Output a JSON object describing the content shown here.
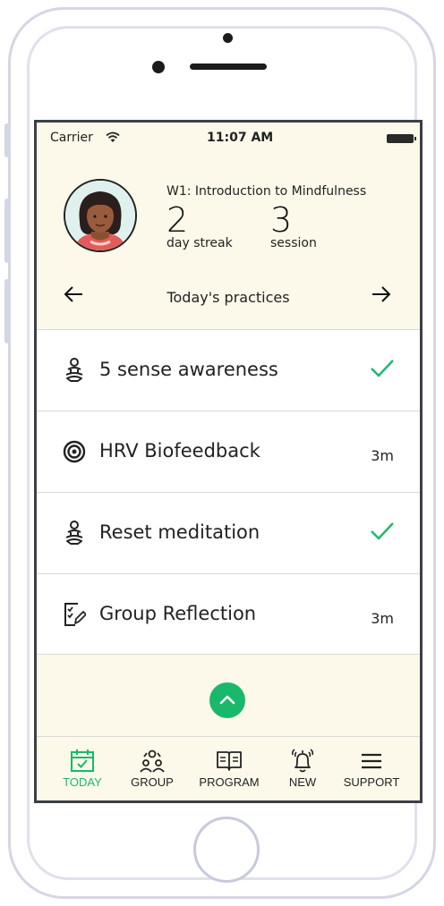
{
  "status_bar": {
    "carrier": "Carrier",
    "time": "11:07 AM"
  },
  "profile": {
    "program_title": "W1: Introduction to Mindfulness",
    "streak_value": "2",
    "streak_label": "day streak",
    "session_value": "3",
    "session_label": "session"
  },
  "navigation": {
    "prev_icon": "arrow-left-icon",
    "title": "Today's practices",
    "next_icon": "arrow-right-icon"
  },
  "practices": [
    {
      "label": "5 sense awareness",
      "icon": "meditation-icon",
      "completed": true,
      "duration": ""
    },
    {
      "label": "HRV Biofeedback",
      "icon": "target-icon",
      "completed": false,
      "duration": "3m"
    },
    {
      "label": "Reset meditation",
      "icon": "meditation-icon",
      "completed": true,
      "duration": ""
    },
    {
      "label": "Group Reflection",
      "icon": "journal-icon",
      "completed": false,
      "duration": "3m"
    }
  ],
  "scroll_up_icon": "chevron-up-icon",
  "tabbar": {
    "active": "TODAY",
    "tabs": [
      {
        "label": "TODAY",
        "icon": "calendar-check-icon"
      },
      {
        "label": "GROUP",
        "icon": "group-icon"
      },
      {
        "label": "PROGRAM",
        "icon": "book-icon"
      },
      {
        "label": "NEW",
        "icon": "bell-icon"
      },
      {
        "label": "SUPPORT",
        "icon": "menu-icon"
      }
    ]
  },
  "colors": {
    "accent": "#1ab86b",
    "background": "#fcf9ea",
    "text": "#222222"
  }
}
